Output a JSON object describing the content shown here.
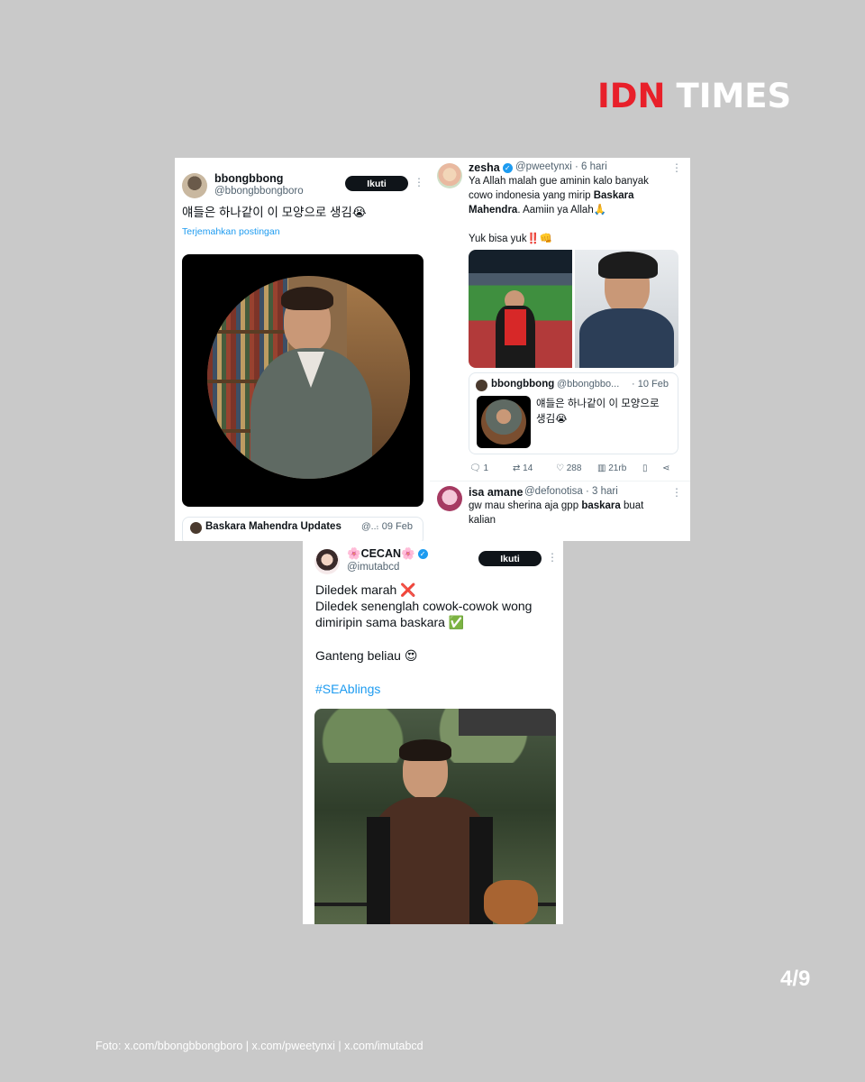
{
  "brand": {
    "logo_left": "IDN",
    "logo_right": "TIMES",
    "accent": "#e8202a"
  },
  "tweet1": {
    "name": "bbongbbong",
    "handle": "@bbongbbongboro",
    "follow": "Ikuti",
    "text": "얘들은 하나같이 이 모양으로 생김😭",
    "translate": "Terjemahkan postingan",
    "quote_name": "Baskara Mahendra Updates",
    "quote_handle": "@...",
    "quote_date": "· 09 Feb"
  },
  "tweet2": {
    "name": "zesha",
    "handle": "@pweetynxi",
    "time": "· 6 hari",
    "line1": "Ya Allah malah gue aminin kalo banyak",
    "line2_pre": "cowo indonesia yang mirip ",
    "line2_bold": "Baskara",
    "line3_bold": "Mahendra",
    "line3_post": ". Aamiin ya Allah🙏",
    "line4": "Yuk bisa yuk‼️👊",
    "quote_name": "bbongbbong",
    "quote_handle": "@bbongbbo...",
    "quote_date": "· 10 Feb",
    "quote_line1": "얘들은 하나같이 이 모양으로",
    "quote_line2": "생김😭",
    "stats": {
      "replies": "1",
      "reposts": "14",
      "likes": "288",
      "views": "21rb"
    }
  },
  "reply": {
    "name": "isa amane",
    "handle": "@defonotisa",
    "time": "· 3 hari",
    "line1_pre": "gw mau sherina aja gpp ",
    "line1_bold": "baskara",
    "line1_post": " buat",
    "line2": "kalian"
  },
  "tweet3": {
    "name": "🌸CECAN🌸",
    "handle": "@imutabcd",
    "follow": "Ikuti",
    "line1": "Diledek marah ❌",
    "line2": "Diledek senenglah cowok-cowok wong",
    "line3": "dimiripin sama baskara ✅",
    "line4": "Ganteng beliau 😍",
    "hashtag": "#SEAblings",
    "hashtag_color": "#1d9bf0"
  },
  "page_indicator": "4/9",
  "credit": "Foto: x.com/bbongbbongboro | x.com/pweetynxi | x.com/imutabcd"
}
